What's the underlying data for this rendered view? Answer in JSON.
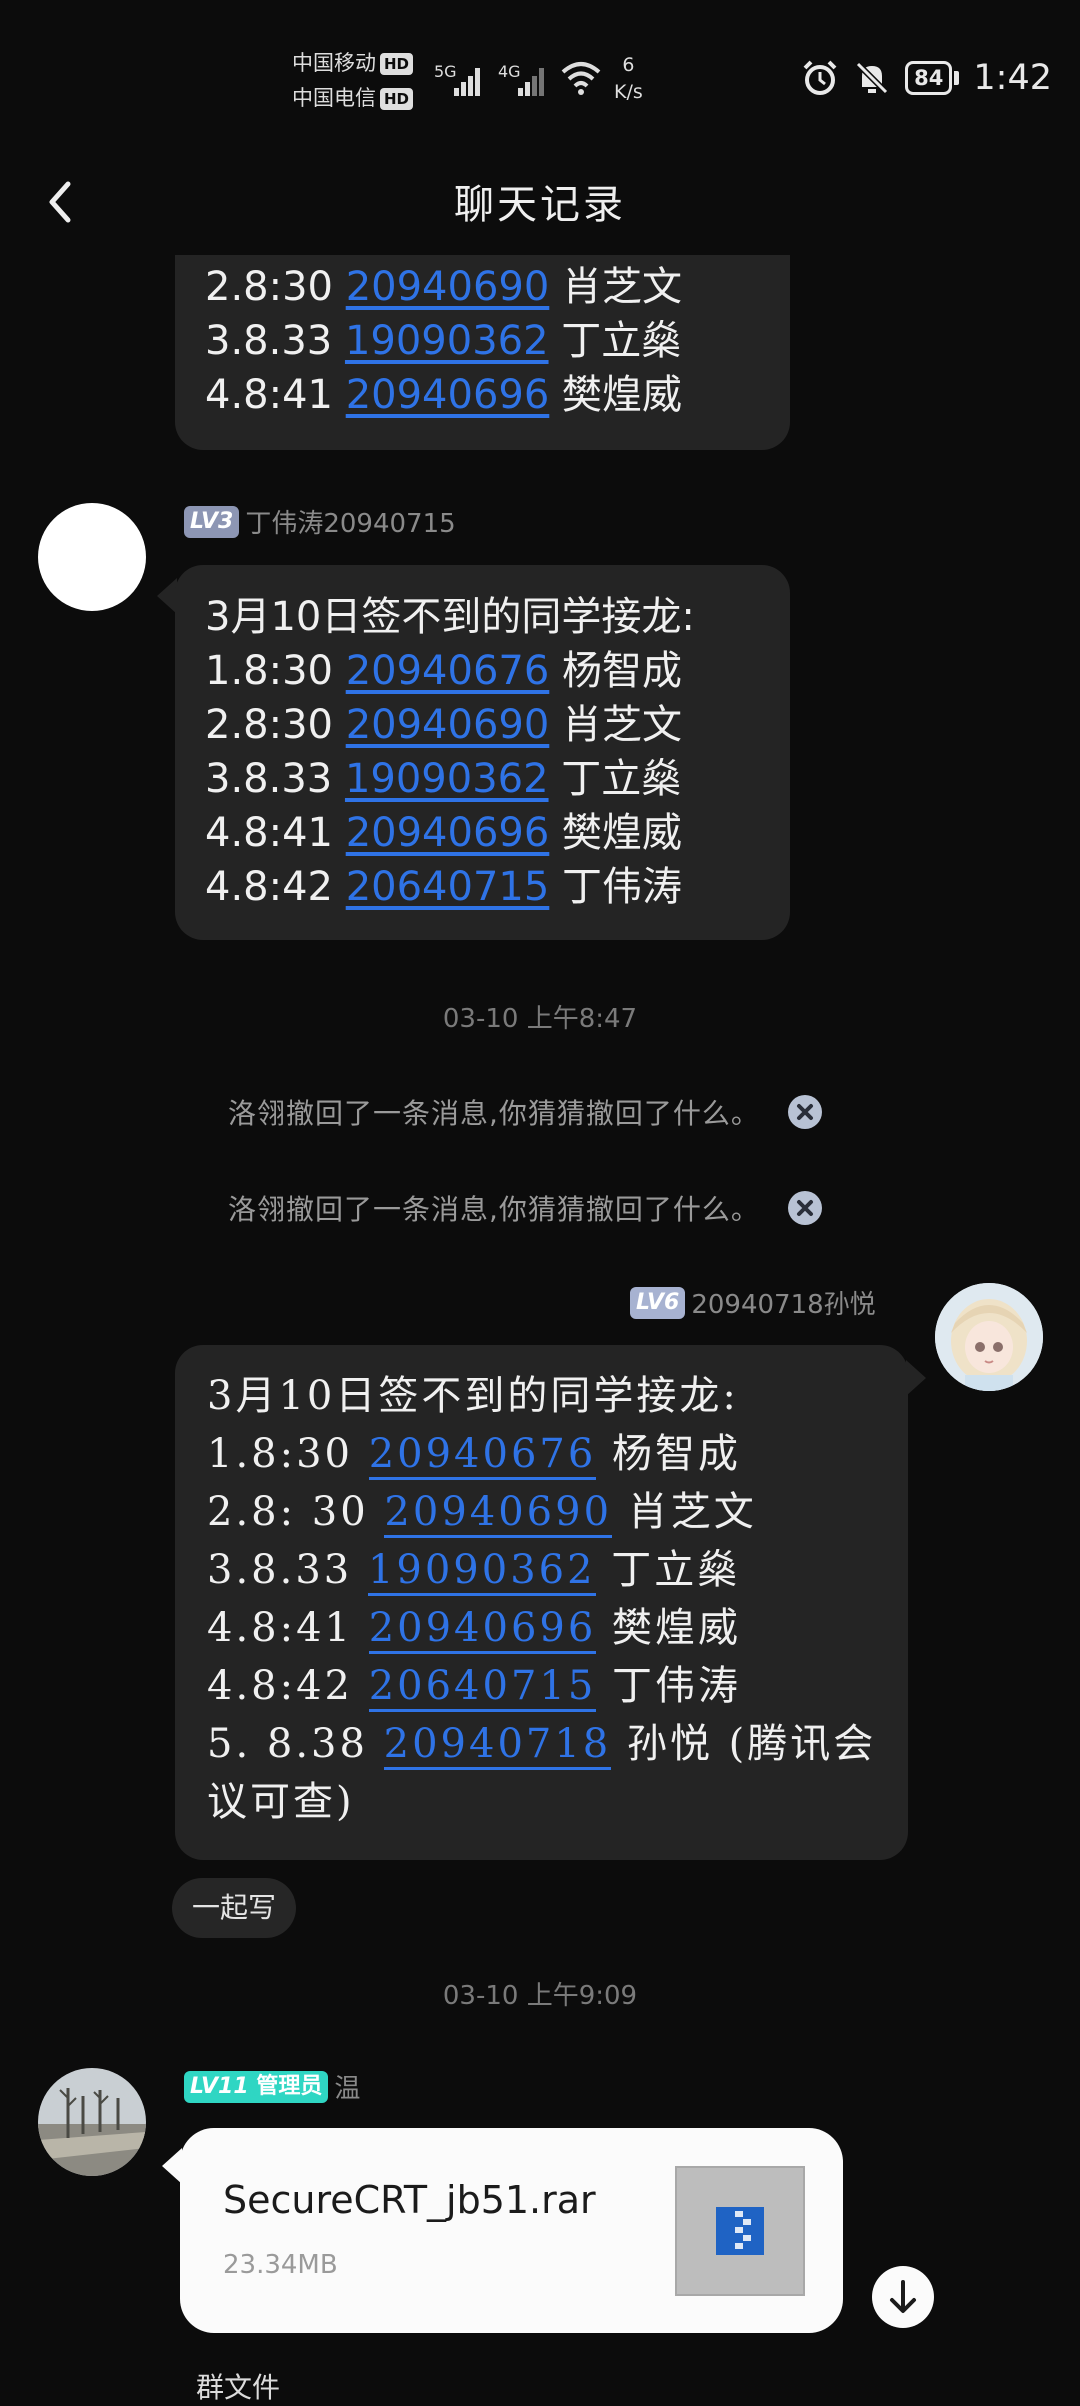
{
  "status_bar": {
    "carrier1": "中国移动",
    "carrier2": "中国电信",
    "hd": "HD",
    "net1": "5G",
    "net2": "4G",
    "speed_value": "6",
    "speed_unit": "K/s",
    "battery": "84",
    "time": "1:42",
    "icons": [
      "alarm-icon",
      "mute-bell-icon",
      "wifi-icon"
    ]
  },
  "header": {
    "title": "聊天记录",
    "back_icon": "chevron-left-icon"
  },
  "messages": [
    {
      "lines": [
        {
          "prefix": "2.8:30 ",
          "num": "20940690",
          "name": " 肖芝文"
        },
        {
          "prefix": "3.8.33 ",
          "num": "19090362",
          "name": " 丁立燊"
        },
        {
          "prefix": "4.8:41 ",
          "num": "20940696",
          "name": " 樊煌威"
        }
      ]
    },
    {
      "level": "LV3",
      "sender": "丁伟涛20940715",
      "heading": "3月10日签不到的同学接龙:",
      "lines": [
        {
          "prefix": "1.8:30 ",
          "num": "20940676",
          "name": " 杨智成"
        },
        {
          "prefix": "2.8:30 ",
          "num": "20940690",
          "name": " 肖芝文"
        },
        {
          "prefix": "3.8.33 ",
          "num": "19090362",
          "name": " 丁立燊"
        },
        {
          "prefix": "4.8:41 ",
          "num": "20940696",
          "name": " 樊煌威"
        },
        {
          "prefix": "4.8:42 ",
          "num": "20640715",
          "name": " 丁伟涛"
        }
      ]
    },
    {
      "level": "LV6",
      "sender": "20940718孙悦",
      "heading": "3月10日签不到的同学接龙:",
      "lines": [
        {
          "prefix": "1.8:30 ",
          "num": "20940676",
          "name": " 杨智成"
        },
        {
          "prefix": "2.8: 30 ",
          "num": "20940690",
          "name": " 肖芝文"
        },
        {
          "prefix": "3.8.33 ",
          "num": "19090362",
          "name": " 丁立燊"
        },
        {
          "prefix": "4.8:41 ",
          "num": "20940696",
          "name": " 樊煌威"
        },
        {
          "prefix": "4.8:42 ",
          "num": "20640715",
          "name": " 丁伟涛"
        },
        {
          "prefix": "5. 8.38 ",
          "num": "20940718",
          "name": " 孙悦 (腾讯会"
        }
      ],
      "tail": "议可查)",
      "chip": "一起写"
    },
    {
      "level": "LV11",
      "role": "管理员",
      "sender": "温",
      "file_name": "SecureCRT_jb51.rar",
      "file_size": "23.34MB",
      "file_label": "群文件"
    }
  ],
  "timestamps": [
    "03-10 上午8:47",
    "03-10 上午9:09"
  ],
  "recall_text": "洛翎撤回了一条消息,你猜猜撤回了什么。",
  "colors": {
    "background": "#0c0c0c",
    "bubble": "#242424",
    "link": "#2f73e6",
    "lv3": "#8d96b4",
    "lv6": "#a7b2d1",
    "lv11": "#2fd6c3"
  }
}
